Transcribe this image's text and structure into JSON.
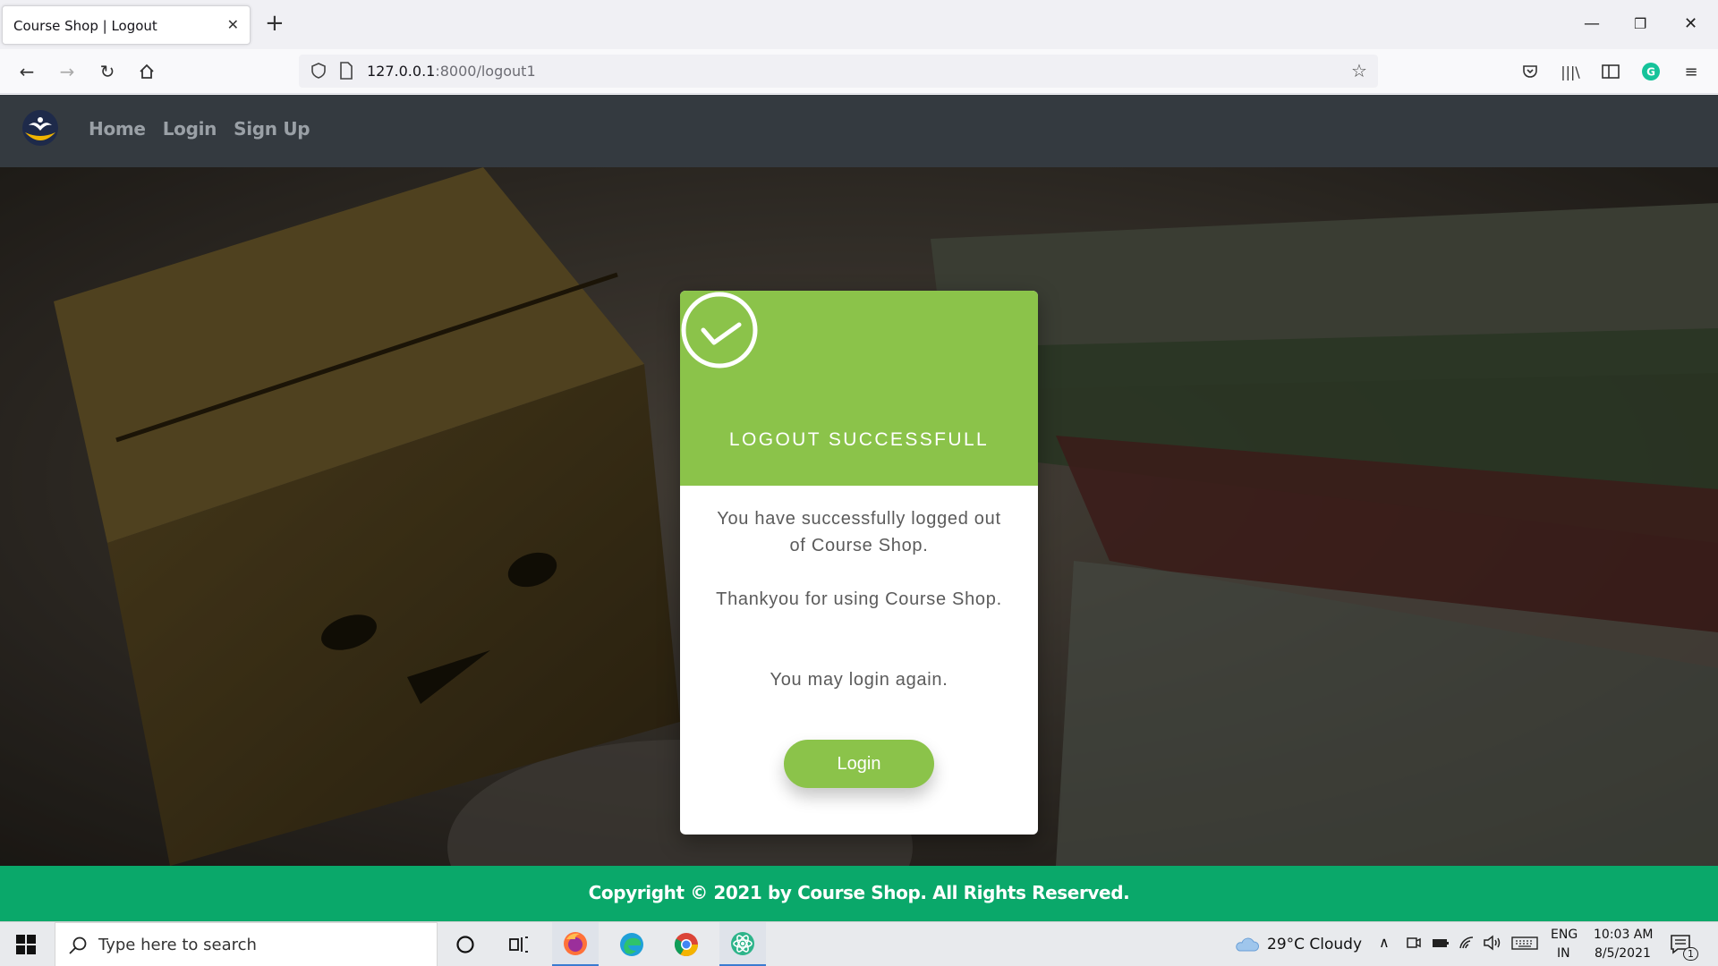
{
  "browser": {
    "tab_title": "Course Shop | Logout",
    "url_host": "127.0.0.1",
    "url_path": ":8000/logout1"
  },
  "site": {
    "nav": [
      "Home",
      "Login",
      "Sign Up"
    ],
    "card": {
      "title": "LOGOUT SUCCESSFULL",
      "message_1": "You have successfully logged out of Course Shop.",
      "message_2": "Thankyou for using Course Shop.",
      "message_3": "You may login again.",
      "button_label": "Login"
    },
    "footer": "Copyright © 2021 by Course Shop. All Rights Reserved.",
    "colors": {
      "accent_green": "#8bc34a",
      "footer_green": "#0aa86a",
      "navbar": "#343a40"
    }
  },
  "taskbar": {
    "search_placeholder": "Type here to search",
    "weather": "29°C  Cloudy",
    "lang_1": "ENG",
    "lang_2": "IN",
    "time": "10:03 AM",
    "date": "8/5/2021",
    "notification_count": "1"
  }
}
